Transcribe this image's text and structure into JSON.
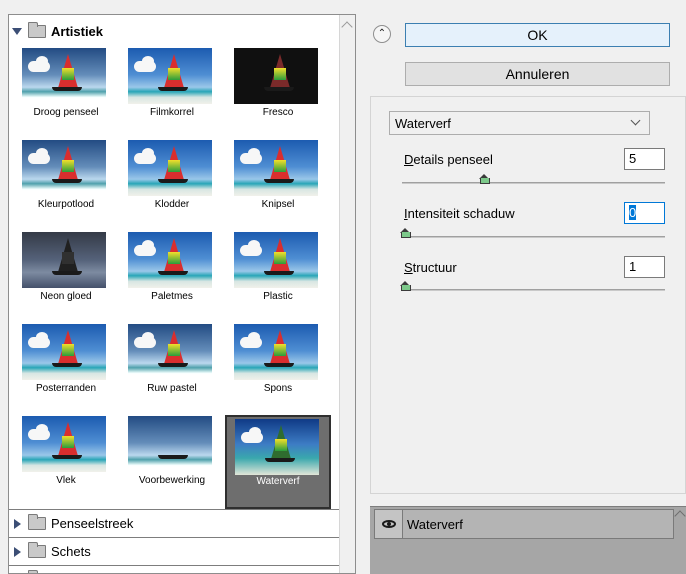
{
  "buttons": {
    "ok": "OK",
    "cancel": "Annuleren"
  },
  "gallery": {
    "open_folder": "Artistiek",
    "thumbnails": [
      "Droog penseel",
      "Filmkorrel",
      "Fresco",
      "Kleurpotlood",
      "Klodder",
      "Knipsel",
      "Neon gloed",
      "Paletmes",
      "Plastic",
      "Posterranden",
      "Ruw pastel",
      "Spons",
      "Vlek",
      "Voorbewerking",
      "Waterverf"
    ],
    "selected": "Waterverf",
    "closed_folders": [
      "Penseelstreek",
      "Schets"
    ]
  },
  "filter_select": {
    "value": "Waterverf"
  },
  "params": [
    {
      "label_ul": "D",
      "label_rest": "etails penseel",
      "value": "5",
      "slider_fraction": 0.3
    },
    {
      "label_ul": "I",
      "label_rest": "ntensiteit schaduw",
      "value": "0",
      "slider_fraction": 0.0
    },
    {
      "label_ul": "S",
      "label_rest": "tructuur",
      "value": "1",
      "slider_fraction": 0.0
    }
  ],
  "layers": {
    "items": [
      "Waterverf"
    ]
  },
  "icons": {
    "collapse": "double-chevron-up-icon",
    "eye": "eye-icon",
    "folder": "folder-icon"
  }
}
